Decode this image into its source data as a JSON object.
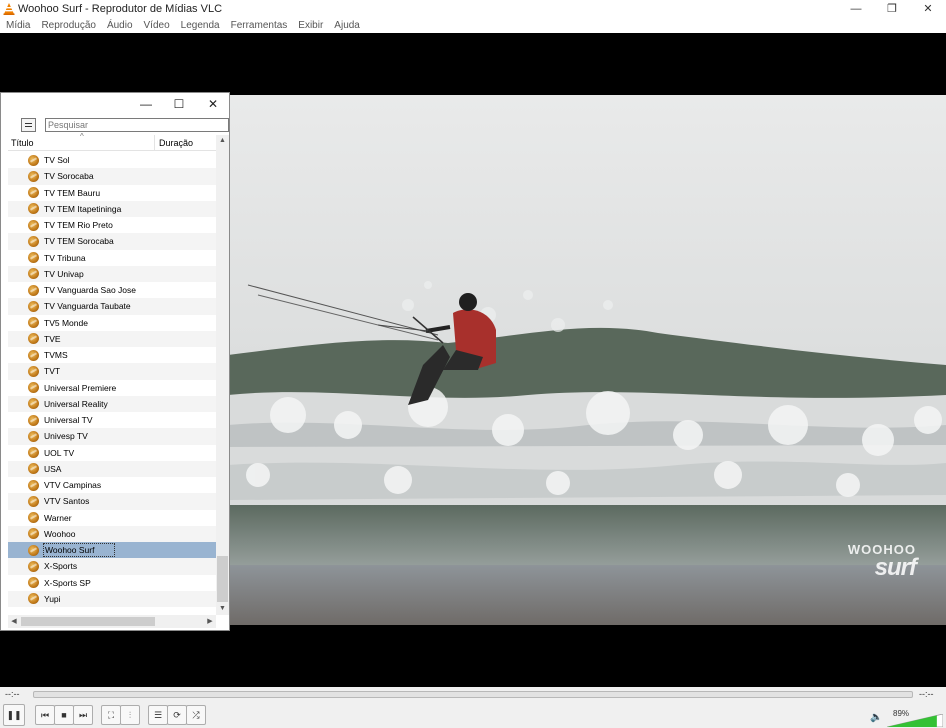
{
  "window": {
    "title": "Woohoo Surf - Reprodutor de Mídias VLC",
    "minimize": "—",
    "maximize": "❐",
    "close": "✕"
  },
  "menu": [
    "Mídia",
    "Reprodução",
    "Áudio",
    "Vídeo",
    "Legenda",
    "Ferramentas",
    "Exibir",
    "Ajuda"
  ],
  "video": {
    "watermark_line1": "WOOHOO",
    "watermark_line2": "surf"
  },
  "playlist": {
    "minimize": "—",
    "maximize": "☐",
    "close": "✕",
    "search_placeholder": "Pesquisar",
    "col_title": "Título",
    "col_duration": "Duração",
    "sort_caret": "^",
    "items": [
      "TV Sol",
      "TV Sorocaba",
      "TV TEM Bauru",
      "TV TEM Itapetininga",
      "TV TEM Rio Preto",
      "TV TEM Sorocaba",
      "TV Tribuna",
      "TV Univap",
      "TV Vanguarda Sao Jose",
      "TV Vanguarda Taubate",
      "TV5 Monde",
      "TVE",
      "TVMS",
      "TVT",
      "Universal Premiere",
      "Universal Reality",
      "Universal TV",
      "Univesp TV",
      "UOL TV",
      "USA",
      "VTV Campinas",
      "VTV Santos",
      "Warner",
      "Woohoo",
      "Woohoo Surf",
      "X-Sports",
      "X-Sports SP",
      "Yupi"
    ],
    "selected_index": 24
  },
  "seek": {
    "elapsed": "--:--",
    "remaining": "--:--"
  },
  "controls": {
    "pause": "❚❚",
    "prev": "⏮",
    "stop": "■",
    "next": "⏭",
    "fullscreen": "⛶",
    "extended": "⫶",
    "playlist": "☰",
    "loop": "⟳",
    "shuffle": "⤮",
    "volume_icon": "🔈",
    "volume": "89%",
    "volume_level": 0.89
  }
}
